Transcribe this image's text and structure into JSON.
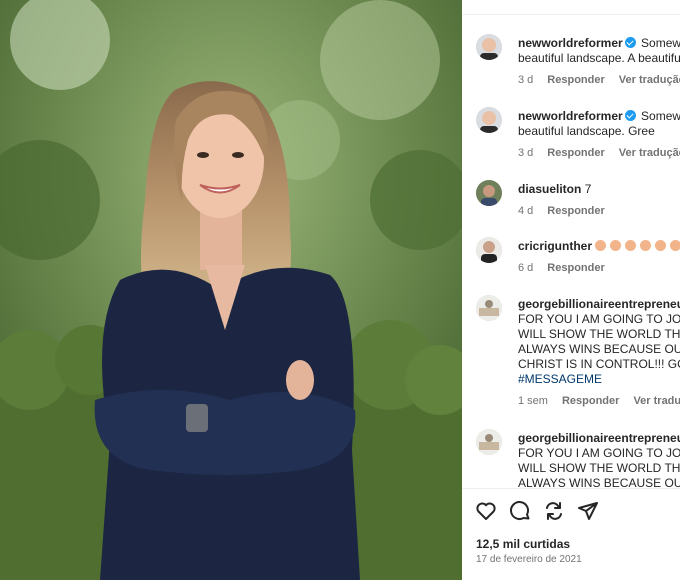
{
  "comments": [
    {
      "username": "newworldreformer",
      "verified": true,
      "text": "Somewhere beautiful landscape. A beautiful",
      "line1": "Somewh",
      "line2": "beautiful landscape. A beautifu",
      "time": "3 d",
      "reply": "Responder",
      "translate": "Ver tradução",
      "more": "••"
    },
    {
      "username": "newworldreformer",
      "verified": true,
      "line1": "Somewh",
      "line2": "beautiful landscape. Gree",
      "time": "3 d",
      "reply": "Responder",
      "translate": "Ver tradução"
    },
    {
      "username": "diasueliton",
      "verified": false,
      "line1": "7",
      "time": "4 d",
      "reply": "Responder"
    },
    {
      "username": "cricrigunther",
      "verified": false,
      "time": "6 d",
      "reply": "Responder"
    },
    {
      "username": "georgebillionaireentrepreneu",
      "verified": false,
      "lines": [
        "FOR YOU I AM GOING TO JOIN",
        "WILL SHOW THE WORLD THAT",
        "ALWAYS WINS BECAUSE OUR L",
        "CHRIST IS IN CONTROL!!! GOD"
      ],
      "hashtag": "#MESSAGEME",
      "time": "1 sem",
      "reply": "Responder",
      "translate": "Ver tradução"
    },
    {
      "username": "georgebillionaireentrepreneu",
      "verified": false,
      "lines": [
        "FOR YOU I AM GOING TO JOIN",
        "WILL SHOW THE WORLD THAT",
        "ALWAYS WINS BECAUSE OUR L"
      ]
    }
  ],
  "footer": {
    "likes": "12,5 mil curtidas",
    "date": "17 de fevereiro de 2021"
  },
  "icons": {
    "like": "heart-icon",
    "comment": "comment-bubble-icon",
    "share": "share-icon",
    "send": "paper-plane-icon"
  },
  "colors": {
    "verified": "#1d9bf0",
    "hashtag": "#00376b",
    "meta": "#737373"
  }
}
